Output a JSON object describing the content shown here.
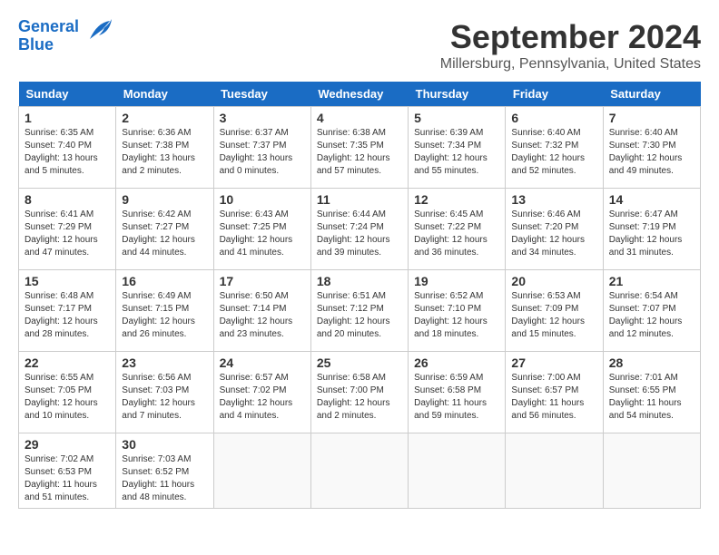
{
  "logo": {
    "line1": "General",
    "line2": "Blue"
  },
  "title": "September 2024",
  "location": "Millersburg, Pennsylvania, United States",
  "weekdays": [
    "Sunday",
    "Monday",
    "Tuesday",
    "Wednesday",
    "Thursday",
    "Friday",
    "Saturday"
  ],
  "weeks": [
    [
      {
        "day": "1",
        "sunrise": "6:35 AM",
        "sunset": "7:40 PM",
        "daylight": "13 hours and 5 minutes."
      },
      {
        "day": "2",
        "sunrise": "6:36 AM",
        "sunset": "7:38 PM",
        "daylight": "13 hours and 2 minutes."
      },
      {
        "day": "3",
        "sunrise": "6:37 AM",
        "sunset": "7:37 PM",
        "daylight": "13 hours and 0 minutes."
      },
      {
        "day": "4",
        "sunrise": "6:38 AM",
        "sunset": "7:35 PM",
        "daylight": "12 hours and 57 minutes."
      },
      {
        "day": "5",
        "sunrise": "6:39 AM",
        "sunset": "7:34 PM",
        "daylight": "12 hours and 55 minutes."
      },
      {
        "day": "6",
        "sunrise": "6:40 AM",
        "sunset": "7:32 PM",
        "daylight": "12 hours and 52 minutes."
      },
      {
        "day": "7",
        "sunrise": "6:40 AM",
        "sunset": "7:30 PM",
        "daylight": "12 hours and 49 minutes."
      }
    ],
    [
      {
        "day": "8",
        "sunrise": "6:41 AM",
        "sunset": "7:29 PM",
        "daylight": "12 hours and 47 minutes."
      },
      {
        "day": "9",
        "sunrise": "6:42 AM",
        "sunset": "7:27 PM",
        "daylight": "12 hours and 44 minutes."
      },
      {
        "day": "10",
        "sunrise": "6:43 AM",
        "sunset": "7:25 PM",
        "daylight": "12 hours and 41 minutes."
      },
      {
        "day": "11",
        "sunrise": "6:44 AM",
        "sunset": "7:24 PM",
        "daylight": "12 hours and 39 minutes."
      },
      {
        "day": "12",
        "sunrise": "6:45 AM",
        "sunset": "7:22 PM",
        "daylight": "12 hours and 36 minutes."
      },
      {
        "day": "13",
        "sunrise": "6:46 AM",
        "sunset": "7:20 PM",
        "daylight": "12 hours and 34 minutes."
      },
      {
        "day": "14",
        "sunrise": "6:47 AM",
        "sunset": "7:19 PM",
        "daylight": "12 hours and 31 minutes."
      }
    ],
    [
      {
        "day": "15",
        "sunrise": "6:48 AM",
        "sunset": "7:17 PM",
        "daylight": "12 hours and 28 minutes."
      },
      {
        "day": "16",
        "sunrise": "6:49 AM",
        "sunset": "7:15 PM",
        "daylight": "12 hours and 26 minutes."
      },
      {
        "day": "17",
        "sunrise": "6:50 AM",
        "sunset": "7:14 PM",
        "daylight": "12 hours and 23 minutes."
      },
      {
        "day": "18",
        "sunrise": "6:51 AM",
        "sunset": "7:12 PM",
        "daylight": "12 hours and 20 minutes."
      },
      {
        "day": "19",
        "sunrise": "6:52 AM",
        "sunset": "7:10 PM",
        "daylight": "12 hours and 18 minutes."
      },
      {
        "day": "20",
        "sunrise": "6:53 AM",
        "sunset": "7:09 PM",
        "daylight": "12 hours and 15 minutes."
      },
      {
        "day": "21",
        "sunrise": "6:54 AM",
        "sunset": "7:07 PM",
        "daylight": "12 hours and 12 minutes."
      }
    ],
    [
      {
        "day": "22",
        "sunrise": "6:55 AM",
        "sunset": "7:05 PM",
        "daylight": "12 hours and 10 minutes."
      },
      {
        "day": "23",
        "sunrise": "6:56 AM",
        "sunset": "7:03 PM",
        "daylight": "12 hours and 7 minutes."
      },
      {
        "day": "24",
        "sunrise": "6:57 AM",
        "sunset": "7:02 PM",
        "daylight": "12 hours and 4 minutes."
      },
      {
        "day": "25",
        "sunrise": "6:58 AM",
        "sunset": "7:00 PM",
        "daylight": "12 hours and 2 minutes."
      },
      {
        "day": "26",
        "sunrise": "6:59 AM",
        "sunset": "6:58 PM",
        "daylight": "11 hours and 59 minutes."
      },
      {
        "day": "27",
        "sunrise": "7:00 AM",
        "sunset": "6:57 PM",
        "daylight": "11 hours and 56 minutes."
      },
      {
        "day": "28",
        "sunrise": "7:01 AM",
        "sunset": "6:55 PM",
        "daylight": "11 hours and 54 minutes."
      }
    ],
    [
      {
        "day": "29",
        "sunrise": "7:02 AM",
        "sunset": "6:53 PM",
        "daylight": "11 hours and 51 minutes."
      },
      {
        "day": "30",
        "sunrise": "7:03 AM",
        "sunset": "6:52 PM",
        "daylight": "11 hours and 48 minutes."
      },
      null,
      null,
      null,
      null,
      null
    ]
  ]
}
